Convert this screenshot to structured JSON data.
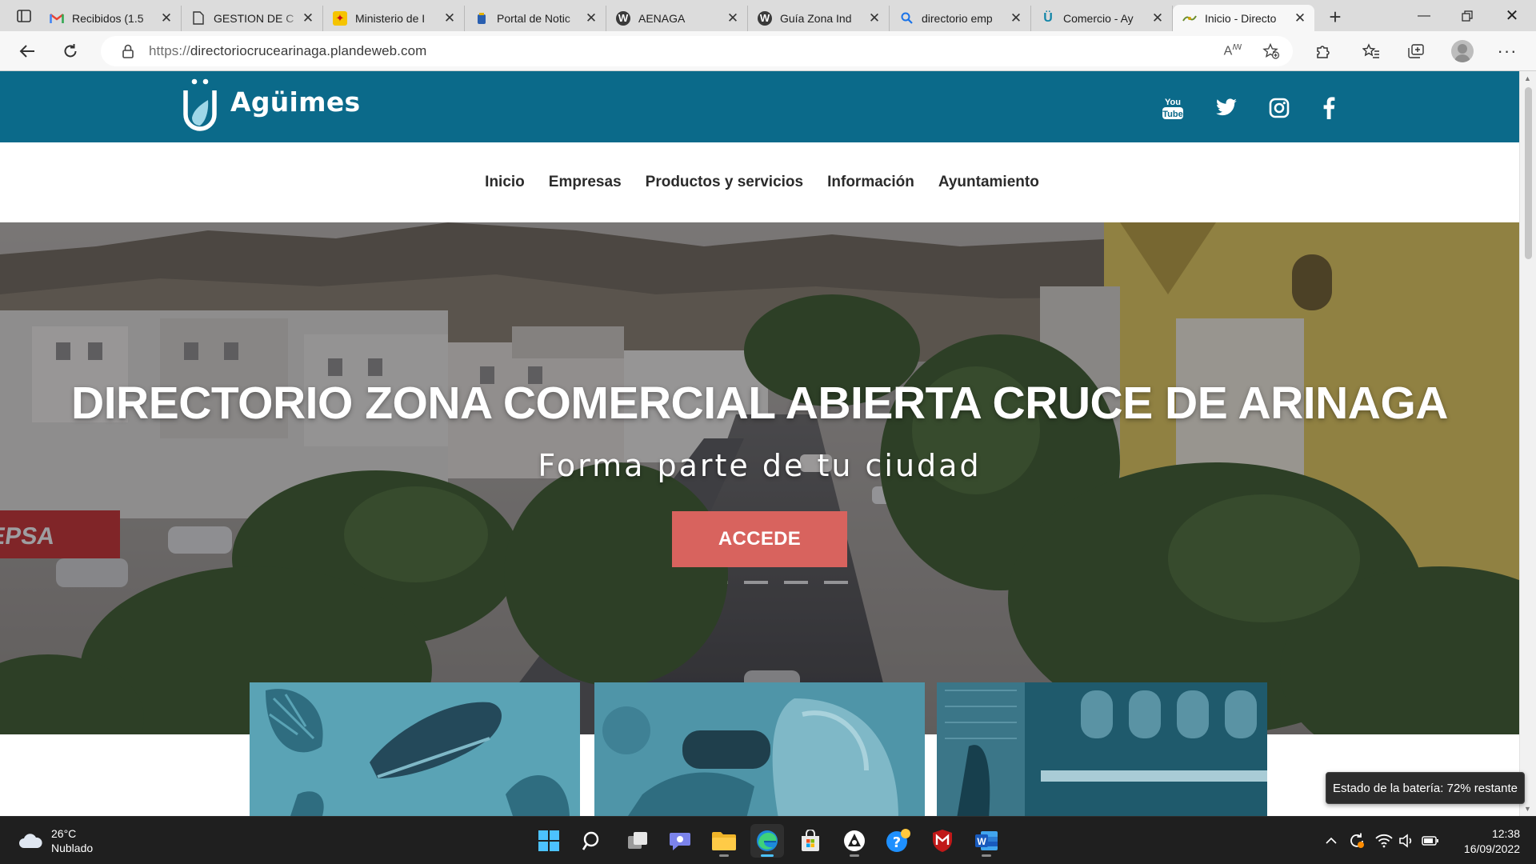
{
  "browser": {
    "tabs": [
      {
        "label": "Recibidos (1.5",
        "favicon": "gmail-icon"
      },
      {
        "label": "GESTION DE C",
        "favicon": "document-icon"
      },
      {
        "label": "Ministerio de I",
        "favicon": "spain-crest-icon"
      },
      {
        "label": "Portal de Notic",
        "favicon": "portal-icon"
      },
      {
        "label": "AENAGA",
        "favicon": "wordpress-icon"
      },
      {
        "label": "Guía Zona Ind",
        "favicon": "wordpress-icon"
      },
      {
        "label": "directorio emp",
        "favicon": "search-icon"
      },
      {
        "label": "Comercio - Ay",
        "favicon": "agumes-icon"
      },
      {
        "label": "Inicio - Directo",
        "favicon": "site-icon",
        "active": true
      }
    ],
    "url_scheme": "https://",
    "url_host": "directoriocrucearinaga.plandeweb.com"
  },
  "site": {
    "logo_text": "Agüimes",
    "brand_color": "#0b6a8a",
    "nav": [
      "Inicio",
      "Empresas",
      "Productos y servicios",
      "Información",
      "Ayuntamiento"
    ],
    "hero": {
      "title": "DIRECTORIO ZONA COMERCIAL ABIERTA CRUCE DE ARINAGA",
      "subtitle": "Forma parte de tu ciudad",
      "cta": "ACCEDE",
      "cta_color": "#d8635e"
    },
    "social": [
      "youtube-icon",
      "twitter-icon",
      "instagram-icon",
      "facebook-icon"
    ]
  },
  "tooltip": {
    "battery": "Estado de la batería: 72% restante"
  },
  "taskbar": {
    "weather_temp": "26°C",
    "weather_desc": "Nublado",
    "time": "12:38",
    "date": "16/09/2022"
  }
}
